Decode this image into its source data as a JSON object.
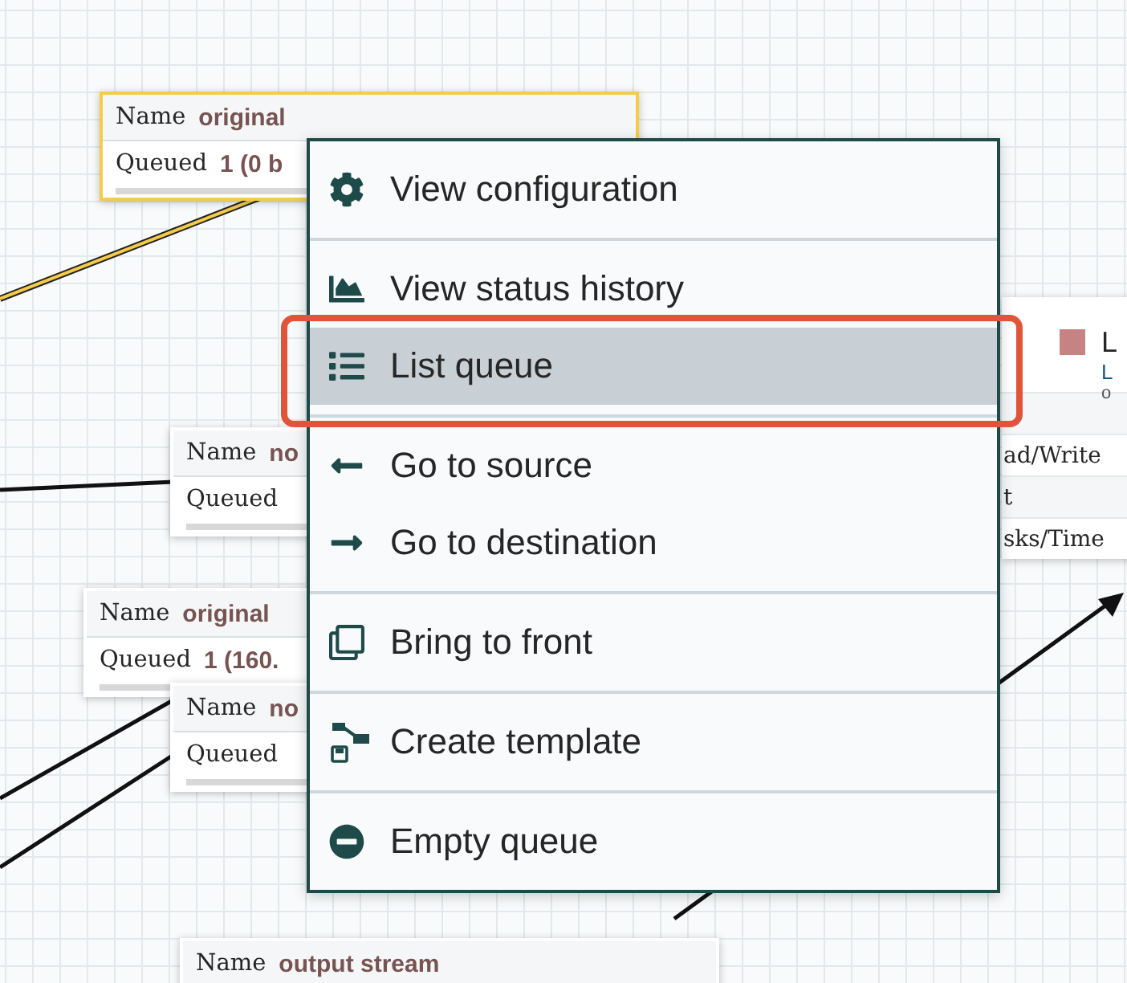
{
  "canvas": {
    "connections": [
      {
        "name_label": "Name",
        "name": "original",
        "queued_label": "Queued",
        "queued": "1 (0 b",
        "selected": true
      },
      {
        "name_label": "Name",
        "name": "no",
        "queued_label": "Queued",
        "selected": false
      },
      {
        "name_label": "Name",
        "name": "original",
        "queued_label": "Queued",
        "queued": "1 (160.",
        "selected": false
      },
      {
        "name_label": "Name",
        "name": "no",
        "queued_label": "Queued",
        "selected": false
      },
      {
        "name_label": "Name",
        "name": "output stream",
        "selected": false
      }
    ],
    "processor": {
      "title": "L",
      "subtitle": "L",
      "detail": "o",
      "rows": [
        "ad/Write",
        "t",
        "sks/Time"
      ]
    }
  },
  "context_menu": {
    "groups": [
      [
        {
          "label": "View configuration",
          "selected": false
        }
      ],
      [
        {
          "label": "View status history",
          "selected": false
        },
        {
          "label": "List queue",
          "selected": true
        }
      ],
      [
        {
          "label": "Go to source",
          "selected": false
        },
        {
          "label": "Go to destination",
          "selected": false
        }
      ],
      [
        {
          "label": "Bring to front",
          "selected": false
        }
      ],
      [
        {
          "label": "Create template",
          "selected": false
        }
      ],
      [
        {
          "label": "Empty queue",
          "selected": false
        }
      ]
    ]
  }
}
